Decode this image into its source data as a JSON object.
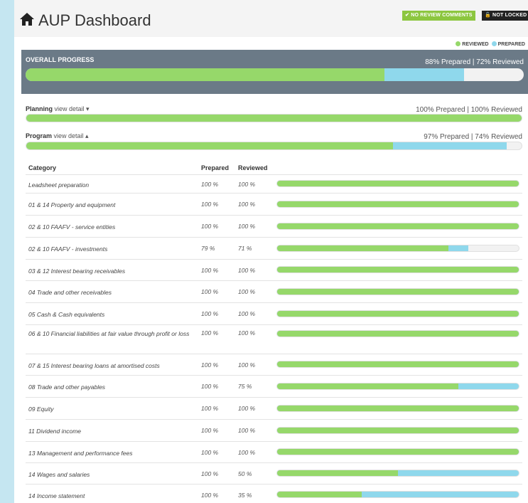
{
  "header": {
    "title": "AUP Dashboard",
    "icon": "home-icon",
    "badges": {
      "review_comments": "✔ NO REVIEW COMMENTS",
      "lock_status": "🔓 NOT LOCKED"
    }
  },
  "legend": {
    "reviewed": "REVIEWED",
    "prepared": "PREPARED"
  },
  "colors": {
    "reviewed": "#96d86a",
    "prepared": "#8fd8ec",
    "track": "#f2f2f2",
    "overall_bg": "#6b7a87",
    "badge_green": "#8cc63f",
    "badge_dark": "#222222"
  },
  "overall": {
    "label": "OVERALL PROGRESS",
    "status": "88% Prepared | 72% Reviewed",
    "prepared": 88,
    "reviewed": 72
  },
  "sections": [
    {
      "name": "Planning",
      "detail": "view detail ▾",
      "status": "100% Prepared | 100% Reviewed",
      "prepared": 100,
      "reviewed": 100
    },
    {
      "name": "Program",
      "detail": "view detail ▴",
      "status": "97% Prepared | 74% Reviewed",
      "prepared": 97,
      "reviewed": 74
    }
  ],
  "table": {
    "headers": {
      "category": "Category",
      "prepared": "Prepared",
      "reviewed": "Reviewed"
    },
    "rows": [
      {
        "category": "Leadsheet preparation",
        "prepared_label": "100 %",
        "reviewed_label": "100 %",
        "prepared": 100,
        "reviewed": 100
      },
      {
        "category": "01 & 14 Property and equipment",
        "prepared_label": "100 %",
        "reviewed_label": "100 %",
        "prepared": 100,
        "reviewed": 100
      },
      {
        "category": "02 & 10 FAAFV - service entities",
        "prepared_label": "100 %",
        "reviewed_label": "100 %",
        "prepared": 100,
        "reviewed": 100
      },
      {
        "category": "02 & 10 FAAFV - investments",
        "prepared_label": "79 %",
        "reviewed_label": "71 %",
        "prepared": 79,
        "reviewed": 71
      },
      {
        "category": "03 & 12 Interest bearing receivables",
        "prepared_label": "100 %",
        "reviewed_label": "100 %",
        "prepared": 100,
        "reviewed": 100
      },
      {
        "category": "04 Trade and other receivables",
        "prepared_label": "100 %",
        "reviewed_label": "100 %",
        "prepared": 100,
        "reviewed": 100
      },
      {
        "category": "05 Cash & Cash equivalents",
        "prepared_label": "100 %",
        "reviewed_label": "100 %",
        "prepared": 100,
        "reviewed": 100
      },
      {
        "category": "06 & 10 Financial liabilities at fair value through profit or loss",
        "prepared_label": "100 %",
        "reviewed_label": "100 %",
        "prepared": 100,
        "reviewed": 100
      },
      {
        "category": "07 & 15 Interest bearing loans at amortised costs",
        "prepared_label": "100 %",
        "reviewed_label": "100 %",
        "prepared": 100,
        "reviewed": 100
      },
      {
        "category": "08 Trade and other payables",
        "prepared_label": "100 %",
        "reviewed_label": "75 %",
        "prepared": 100,
        "reviewed": 75
      },
      {
        "category": "09 Equity",
        "prepared_label": "100 %",
        "reviewed_label": "100 %",
        "prepared": 100,
        "reviewed": 100
      },
      {
        "category": "11 Dividend income",
        "prepared_label": "100 %",
        "reviewed_label": "100 %",
        "prepared": 100,
        "reviewed": 100
      },
      {
        "category": "13 Management and performance fees",
        "prepared_label": "100 %",
        "reviewed_label": "100 %",
        "prepared": 100,
        "reviewed": 100
      },
      {
        "category": "14 Wages and salaries",
        "prepared_label": "100 %",
        "reviewed_label": "50 %",
        "prepared": 100,
        "reviewed": 50
      },
      {
        "category": "14 Income statement",
        "prepared_label": "100 %",
        "reviewed_label": "35 %",
        "prepared": 100,
        "reviewed": 35
      }
    ]
  }
}
